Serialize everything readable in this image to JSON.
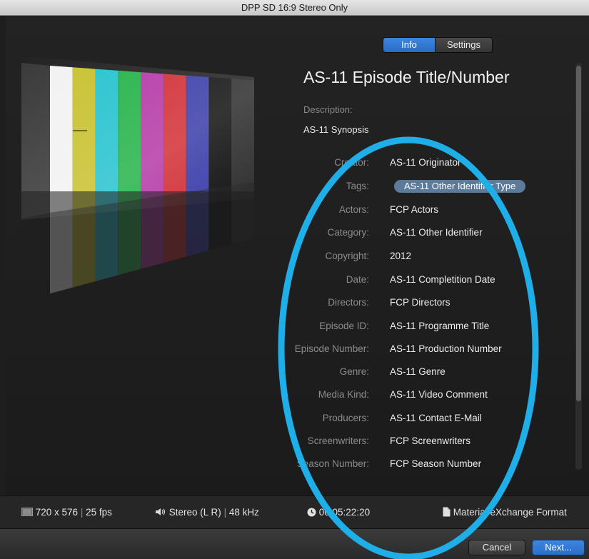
{
  "window": {
    "title": "DPP SD 16:9 Stereo Only"
  },
  "tabs": {
    "info": "Info",
    "settings": "Settings"
  },
  "preview": {
    "bar_colors": [
      "#f2f2f2",
      "#c8c231",
      "#27c3cf",
      "#26b34a",
      "#b53aa7",
      "#d12f35",
      "#3a3ca8",
      "#111111",
      "#2d2d2d"
    ]
  },
  "metadata": {
    "title": "AS-11 Episode Title/Number",
    "description_label": "Description:",
    "description_value": "AS-11 Synopsis",
    "fields": [
      {
        "label": "Creator:",
        "value": "AS-11 Originator"
      },
      {
        "label": "Tags:",
        "value": "AS-11 Other Identifier Type",
        "type": "tag"
      },
      {
        "label": "Actors:",
        "value": "FCP Actors"
      },
      {
        "label": "Category:",
        "value": "AS-11 Other Identifier"
      },
      {
        "label": "Copyright:",
        "value": "2012"
      },
      {
        "label": "Date:",
        "value": "AS-11 Completition Date"
      },
      {
        "label": "Directors:",
        "value": "FCP Directors"
      },
      {
        "label": "Episode ID:",
        "value": "AS-11 Programme Title"
      },
      {
        "label": "Episode Number:",
        "value": "AS-11 Production Number"
      },
      {
        "label": "Genre:",
        "value": "AS-11 Genre"
      },
      {
        "label": "Media Kind:",
        "value": "AS-11 Video Comment"
      },
      {
        "label": "Producers:",
        "value": "AS-11 Contact E-Mail"
      },
      {
        "label": "Screenwriters:",
        "value": "FCP Screenwriters"
      },
      {
        "label": "Season Number:",
        "value": "FCP Season Number"
      }
    ]
  },
  "status": {
    "resolution": "720 x 576",
    "fps": "25 fps",
    "audio": "Stereo (L R)",
    "sample_rate": "48 kHz",
    "duration": "00:05:22:20",
    "format": "Material eXchange Format",
    "separator": "|"
  },
  "buttons": {
    "cancel": "Cancel",
    "next": "Next..."
  },
  "annotation": {
    "color": "#1eaee8"
  },
  "colors": {
    "accent": "#2f74d0",
    "tag_bg": "#5c7a99"
  }
}
